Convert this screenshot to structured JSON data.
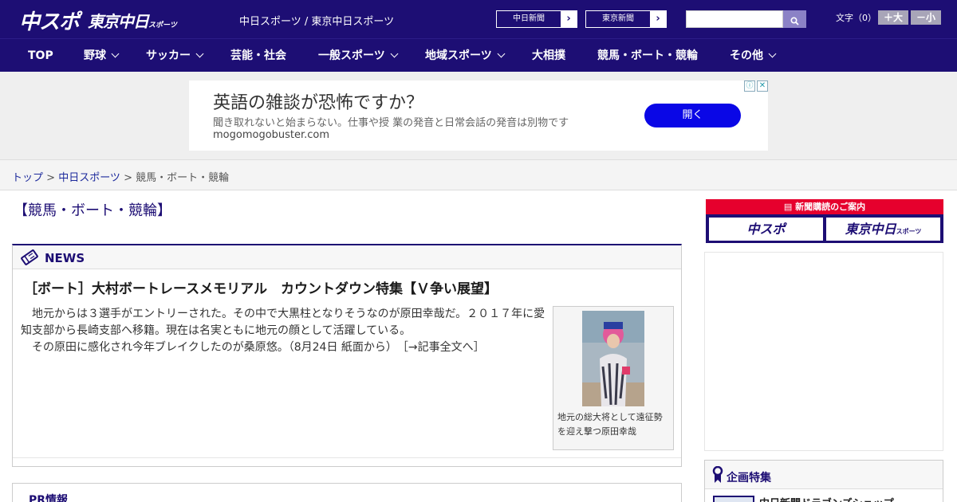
{
  "header": {
    "logo_chuspo": "中スポ",
    "logo_tokyo": "東京中日",
    "logo_tokyo_sub": "スポーツ",
    "site_names": "中日スポーツ / 東京中日スポーツ",
    "paper_links": [
      {
        "label": "中日新聞"
      },
      {
        "label": "東京新聞"
      }
    ],
    "search_placeholder": "",
    "font_size_label": "文字（0）",
    "font_up": "＋大",
    "font_down": "－小"
  },
  "nav": {
    "items": [
      {
        "label": "TOP",
        "has_menu": false
      },
      {
        "label": "野球",
        "has_menu": true
      },
      {
        "label": "サッカー",
        "has_menu": true
      },
      {
        "label": "芸能・社会",
        "has_menu": false
      },
      {
        "label": "一般スポーツ",
        "has_menu": true
      },
      {
        "label": "地域スポーツ",
        "has_menu": true
      },
      {
        "label": "大相撲",
        "has_menu": false
      },
      {
        "label": "競馬・ボート・競輪",
        "has_menu": false
      },
      {
        "label": "その他",
        "has_menu": true
      }
    ]
  },
  "ad": {
    "title": "英語の雑談が恐怖ですか？",
    "description": "聞き取れないと始まらない。仕事や授 業の発音と日常会話の発音は別物です",
    "domain": "mogomogobuster.com",
    "open_label": "開く",
    "choices_icon": "ⓘ",
    "close_icon": "✕",
    "button_color": "#0a07e6"
  },
  "breadcrumb": {
    "items": [
      {
        "label": "トップ",
        "link": true
      },
      {
        "label": "中日スポーツ",
        "link": true
      },
      {
        "label": "競馬・ボート・競輪",
        "link": false
      }
    ],
    "separator": " > "
  },
  "main": {
    "page_title": "【競馬・ボート・競輪】",
    "news_label": "NEWS",
    "article": {
      "title": "［ボート］大村ボートレースメモリアル　カウントダウン特集【Ｖ争い展望】",
      "paragraph1": "　地元からは３選手がエントリーされた。その中で大黒柱となりそうなのが原田幸哉だ。２０１７年に愛知支部から長崎支部へ移籍。現在は名実ともに地元の顔として活躍している。",
      "paragraph2": "　その原田に感化され今年ブレイクしたのが桑原悠。（8月24日 紙面から）",
      "more_link": "［→記事全文へ］",
      "photo_caption": "地元の総大将として遠征勢を迎え撃つ原田幸哉"
    },
    "pr_label": "PR情報"
  },
  "sidebar": {
    "subscription_head": "新聞購読のご案内",
    "subscription_chuspo": "中スポ",
    "subscription_tokyo": "東京中日",
    "subscription_tokyo_sub": "スポーツ",
    "feature_label": "企画特集",
    "feature_item": "中日新聞ドラゴンズショップ"
  },
  "colors": {
    "brand": "#1d0e74",
    "subscription_red": "#e6002d"
  }
}
